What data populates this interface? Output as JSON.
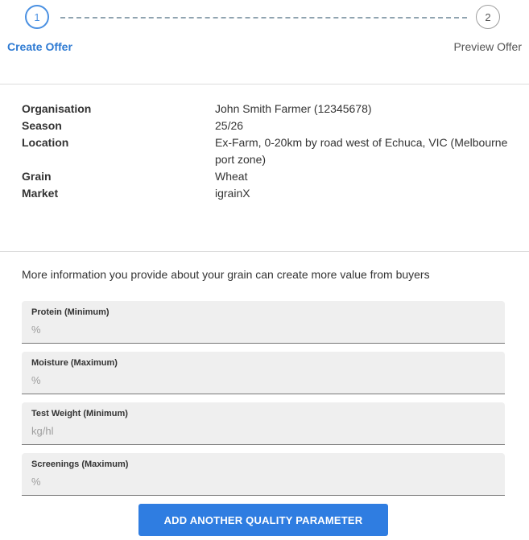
{
  "stepper": {
    "steps": [
      {
        "number": "1",
        "label": "Create Offer",
        "state": "active"
      },
      {
        "number": "2",
        "label": "Preview Offer",
        "state": "inactive"
      }
    ],
    "active_color": "#2f7bd3"
  },
  "summary": {
    "organisation": {
      "label": "Organisation",
      "value": "John Smith Farmer (12345678)"
    },
    "season": {
      "label": "Season",
      "value": "25/26"
    },
    "location": {
      "label": "Location",
      "value": "Ex-Farm, 0-20km by road west of Echuca, VIC (Melbourne port zone)"
    },
    "grain": {
      "label": "Grain",
      "value": "Wheat"
    },
    "market": {
      "label": "Market",
      "value": "igrainX"
    }
  },
  "quality": {
    "intro": "More information you provide about your grain can create more value from buyers",
    "fields": [
      {
        "label": "Protein (Minimum)",
        "placeholder": "%",
        "value": ""
      },
      {
        "label": "Moisture (Maximum)",
        "placeholder": "%",
        "value": ""
      },
      {
        "label": "Test Weight (Minimum)",
        "placeholder": "kg/hl",
        "value": ""
      },
      {
        "label": "Screenings (Maximum)",
        "placeholder": "%",
        "value": ""
      }
    ],
    "add_button_label": "ADD ANOTHER QUALITY PARAMETER",
    "button_color": "#2f7de1"
  }
}
